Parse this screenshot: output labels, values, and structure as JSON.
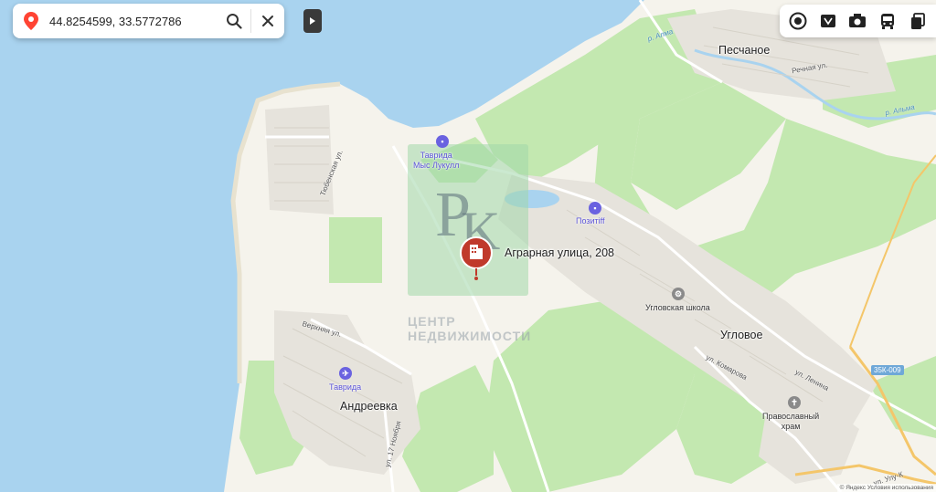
{
  "search": {
    "coords": "44.8254599, 33.5772786",
    "search_icon": "search-icon",
    "clear_icon": "close-icon",
    "pin_icon": "location-pin-icon"
  },
  "layers_toolbar": {
    "items": [
      {
        "name": "layers-icon"
      },
      {
        "name": "panorama-icon"
      },
      {
        "name": "photo-camera-icon"
      },
      {
        "name": "transit-icon"
      },
      {
        "name": "copy-icon"
      }
    ]
  },
  "place": {
    "label": "Аграрная улица, 208",
    "marker_color": "#c0392b"
  },
  "settlements": {
    "peschanoe": "Песчаное",
    "uglovoe": "Угловое",
    "andreevka": "Андреевка"
  },
  "streets": {
    "tyubenskaya": "Тюбенская ул.",
    "rechnaya": "Речная ул.",
    "verkhnyaya": "Верхняя ул.",
    "komarova": "ул. Комарова",
    "lenina": "ул. Ленина",
    "noyabrya": "ул. 17 Ноября",
    "ulu": "ул. Улу-К"
  },
  "rivers": {
    "alma_small": "р. Алма",
    "alma": "р. Альма"
  },
  "pois": {
    "tavrida_hotel": "Таврида\nМыс Лукулл",
    "pozitiff": "Позитiff",
    "school": "Угловская школа",
    "church": "Православный\nхрам",
    "tavrida_airport": "Таврида"
  },
  "road_badge": "35К-009",
  "watermark": {
    "line1": "ЦЕНТР",
    "line2": "НЕДВИЖИМОСТИ"
  },
  "attribution": "© Яндекс Условия использования",
  "colors": {
    "water": "#a9d3ef",
    "land": "#f5f3ec",
    "field": "#c3e8b0",
    "settlement": "#e6e3dc",
    "poi": "#5a52d6"
  }
}
